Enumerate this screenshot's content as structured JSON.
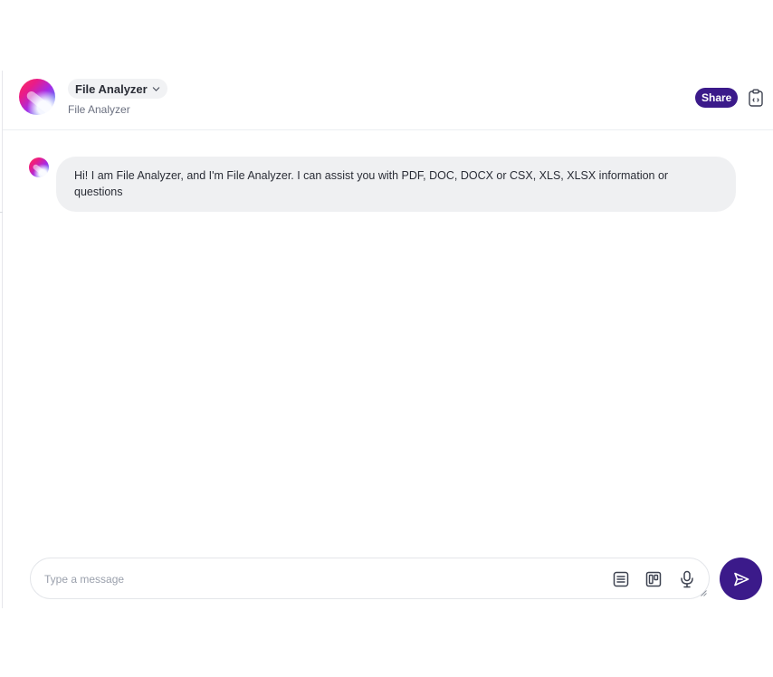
{
  "assistant": {
    "name": "File Analyzer",
    "subtitle": "File Analyzer"
  },
  "header": {
    "share_label": "Share",
    "icons": [
      "chevron-down-icon",
      "clipboard-icon"
    ]
  },
  "messages": [
    {
      "role": "assistant",
      "text": "Hi! I am File Analyzer, and I'm File Analyzer. I can assist you with PDF, DOC, DOCX or CSX, XLS, XLSX information or questions"
    }
  ],
  "composer": {
    "placeholder": "Type a message",
    "value": "",
    "tools": [
      "document-icon",
      "board-icon",
      "microphone-icon"
    ],
    "send_icon": "send-icon"
  },
  "colors": {
    "accent": "#3b1a8a",
    "bubble": "#eff0f2",
    "pill": "#f1f2f4"
  }
}
